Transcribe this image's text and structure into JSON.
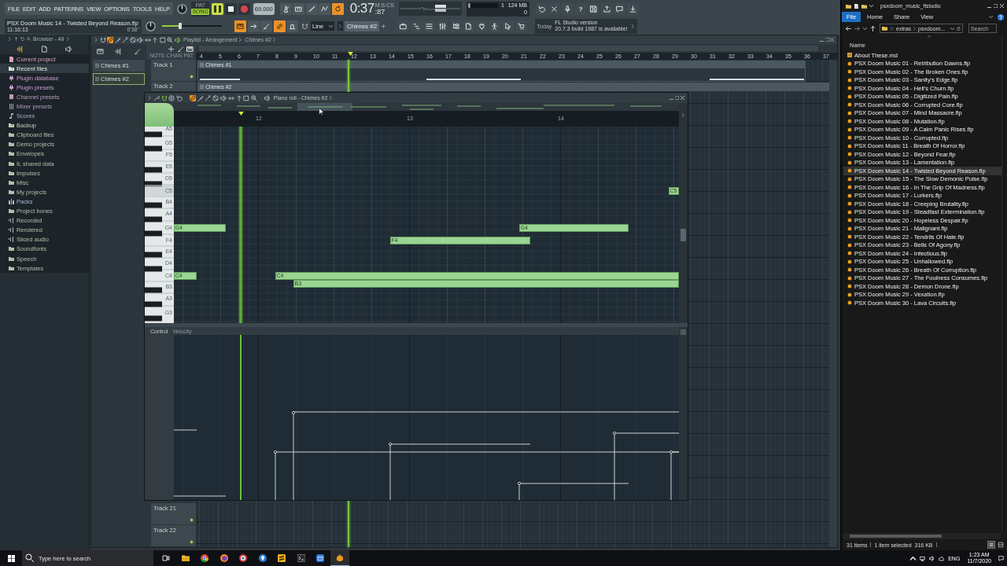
{
  "fl_studio": {
    "menu": [
      "FILE",
      "EDIT",
      "ADD",
      "PATTERNS",
      "VIEW",
      "OPTIONS",
      "TOOLS",
      "HELP"
    ],
    "transport": {
      "modes": [
        {
          "label": "PAT",
          "selected": false
        },
        {
          "label": "SONG",
          "selected": true
        }
      ],
      "playing": true,
      "tempo": "69.000",
      "time": "0:37",
      "time_unit": "M:S:CS",
      "time_fraction": ":87"
    },
    "recording_toggles": [
      {
        "on": false
      },
      {
        "on": false
      },
      {
        "on": false
      },
      {
        "on": false
      },
      {
        "on": true
      }
    ],
    "cpu_panel": {
      "cpu": "1",
      "memory": "124 MB",
      "polyphony": "0"
    },
    "help_button": "?",
    "hint_bar": {
      "title": "PSX Doom Music 14 - Twisted Beyond Reason.flp",
      "time": "11:16:13",
      "length": "0'38\""
    },
    "master_pitch": {
      "level": 0.3
    },
    "edit_toggles": [
      {
        "on": true
      },
      {
        "on": false
      },
      {
        "on": false
      },
      {
        "on": true
      },
      {
        "on": false
      }
    ],
    "snap": "Line",
    "pattern": "Chimes #2",
    "news": {
      "label": "Today",
      "title": "FL Studio version",
      "text": "20.7.3 build 1987 is available!"
    }
  },
  "browser": {
    "title": "Browser - All",
    "items": [
      {
        "label": "Current project",
        "kind": "project",
        "color": "#d9a2b2",
        "selected": false
      },
      {
        "label": "Recent files",
        "kind": "recent",
        "color": "#dfe8d8",
        "selected": true
      },
      {
        "label": "Plugin database",
        "kind": "plugin",
        "color": "#c89ccc",
        "selected": false
      },
      {
        "label": "Plugin presets",
        "kind": "plugin",
        "color": "#c89ccc",
        "selected": false
      },
      {
        "label": "Channel presets",
        "kind": "preset",
        "color": "#b89cbc",
        "selected": false
      },
      {
        "label": "Mixer presets",
        "kind": "mixer",
        "color": "#b09cbc",
        "selected": false
      },
      {
        "label": "Scores",
        "kind": "score",
        "color": "#b0a8c4",
        "selected": false
      },
      {
        "label": "Backup",
        "kind": "recent",
        "color": "#bcd0b4",
        "selected": false
      },
      {
        "label": "Clipboard files",
        "kind": "folder",
        "color": "#b4bcac",
        "selected": false
      },
      {
        "label": "Demo projects",
        "kind": "folder",
        "color": "#b4bcac",
        "selected": false
      },
      {
        "label": "Envelopes",
        "kind": "folder",
        "color": "#b4bcac",
        "selected": false
      },
      {
        "label": "IL shared data",
        "kind": "folder",
        "color": "#b4bcac",
        "selected": false
      },
      {
        "label": "Impulses",
        "kind": "folder",
        "color": "#b4bcac",
        "selected": false
      },
      {
        "label": "Misc",
        "kind": "folder",
        "color": "#b4bcac",
        "selected": false
      },
      {
        "label": "My projects",
        "kind": "folder",
        "color": "#b4bcac",
        "selected": false
      },
      {
        "label": "Packs",
        "kind": "pack",
        "color": "#a8b8d4",
        "selected": false
      },
      {
        "label": "Project bones",
        "kind": "folder",
        "color": "#b4bcac",
        "selected": false
      },
      {
        "label": "Recorded",
        "kind": "audio",
        "color": "#b4bcac",
        "selected": false
      },
      {
        "label": "Rendered",
        "kind": "audio",
        "color": "#b4bcac",
        "selected": false
      },
      {
        "label": "Sliced audio",
        "kind": "audio",
        "color": "#b4bcac",
        "selected": false
      },
      {
        "label": "Soundfonts",
        "kind": "folder",
        "color": "#b4bcac",
        "selected": false
      },
      {
        "label": "Speech",
        "kind": "folder",
        "color": "#b4bcac",
        "selected": false
      },
      {
        "label": "Templates",
        "kind": "folder",
        "color": "#b4bcac",
        "selected": false
      }
    ]
  },
  "patterns": [
    {
      "label": "Chimes #1",
      "selected": false
    },
    {
      "label": "Chimes #2",
      "selected": true
    }
  ],
  "playlist": {
    "title": "Playlist - Arrangement",
    "pattern": "Chimes #2",
    "tools": [
      {
        "selected": true
      },
      {
        "selected": false
      },
      {
        "selected": false
      },
      {
        "selected": false
      },
      {
        "selected": false
      },
      {
        "selected": false
      },
      {
        "selected": false
      },
      {
        "selected": false
      },
      {
        "selected": false
      }
    ],
    "tool_labels": [
      "NOTE",
      "CHAN",
      "PAT"
    ],
    "ruler": [
      "4",
      "5",
      "6",
      "7",
      "8",
      "9",
      "10",
      "11",
      "12",
      "13",
      "14",
      "15",
      "16",
      "17",
      "18",
      "19",
      "20",
      "21",
      "22",
      "23",
      "24",
      "25",
      "26",
      "27",
      "28",
      "29",
      "30",
      "31",
      "32",
      "33",
      "34",
      "35",
      "36",
      "37"
    ],
    "tracks": [
      {
        "name": "Track 1",
        "clip": "Chimes #1"
      },
      {
        "name": "Track 2",
        "clip": "Chimes #2"
      }
    ],
    "lower_tracks": [
      {
        "name": "Track 21"
      },
      {
        "name": "Track 22"
      }
    ]
  },
  "piano_roll": {
    "title": "Piano roll - Chimes #2",
    "tools": [
      {
        "selected": true
      },
      {
        "selected": false
      },
      {
        "selected": false
      },
      {
        "selected": false
      },
      {
        "selected": false
      },
      {
        "selected": false
      },
      {
        "selected": false
      },
      {
        "selected": false
      },
      {
        "selected": false
      }
    ],
    "ruler": [
      "12",
      "13",
      "14"
    ],
    "keys": [
      "A5",
      "G5",
      "F5",
      "E5",
      "D5",
      "C5",
      "B4",
      "A4",
      "G4",
      "F4",
      "E4",
      "D4",
      "C4",
      "B3",
      "A3",
      "G3"
    ],
    "notes": [
      {
        "label": "G4"
      },
      {
        "label": "C4"
      },
      {
        "label": "C4"
      },
      {
        "label": "B3"
      },
      {
        "label": "F4"
      },
      {
        "label": "G4"
      },
      {
        "label": "C5"
      }
    ],
    "control": {
      "label": "Control",
      "target": "Velocity"
    }
  },
  "explorer": {
    "title": "psxdoom_music_flstudio",
    "ribbon": [
      {
        "label": "File",
        "selected": true
      },
      {
        "label": "Home",
        "selected": false
      },
      {
        "label": "Share",
        "selected": false
      },
      {
        "label": "View",
        "selected": false
      }
    ],
    "path": [
      "extras",
      "psxdoom..."
    ],
    "search": {
      "placeholder": "Search"
    },
    "column": "Name",
    "files": [
      {
        "name": "About These.md",
        "kind": "md",
        "selected": false
      },
      {
        "name": "PSX Doom Music 01 - Retribution Dawns.flp",
        "kind": "flp",
        "selected": false
      },
      {
        "name": "PSX Doom Music 02 - The Broken Ones.flp",
        "kind": "flp",
        "selected": false
      },
      {
        "name": "PSX Doom Music 03 - Sanity's Edge.flp",
        "kind": "flp",
        "selected": false
      },
      {
        "name": "PSX Doom Music 04 - Hell's Churn.flp",
        "kind": "flp",
        "selected": false
      },
      {
        "name": "PSX Doom Music 05 - Digitized Pain.flp",
        "kind": "flp",
        "selected": false
      },
      {
        "name": "PSX Doom Music 06 - Corrupted Core.flp",
        "kind": "flp",
        "selected": false
      },
      {
        "name": "PSX Doom Music 07 - Mind Massacre.flp",
        "kind": "flp",
        "selected": false
      },
      {
        "name": "PSX Doom Music 08 - Mutation.flp",
        "kind": "flp",
        "selected": false
      },
      {
        "name": "PSX Doom Music 09 - A Calm Panic Rises.flp",
        "kind": "flp",
        "selected": false
      },
      {
        "name": "PSX Doom Music 10 - Corrupted.flp",
        "kind": "flp",
        "selected": false
      },
      {
        "name": "PSX Doom Music 11 - Breath Of Horror.flp",
        "kind": "flp",
        "selected": false
      },
      {
        "name": "PSX Doom Music 12 - Beyond Fear.flp",
        "kind": "flp",
        "selected": false
      },
      {
        "name": "PSX Doom Music 13 - Lamentation.flp",
        "kind": "flp",
        "selected": false
      },
      {
        "name": "PSX Doom Music 14 - Twisted Beyond Reason.flp",
        "kind": "flp",
        "selected": true
      },
      {
        "name": "PSX Doom Music 15 - The Slow Demonic Pulse.flp",
        "kind": "flp",
        "selected": false
      },
      {
        "name": "PSX Doom Music 16 - In The Grip Of Madness.flp",
        "kind": "flp",
        "selected": false
      },
      {
        "name": "PSX Doom Music 17 - Lurkers.flp",
        "kind": "flp",
        "selected": false
      },
      {
        "name": "PSX Doom Music 18 - Creeping Brutality.flp",
        "kind": "flp",
        "selected": false
      },
      {
        "name": "PSX Doom Music 19 - Steadfast Extermination.flp",
        "kind": "flp",
        "selected": false
      },
      {
        "name": "PSX Doom Music 20 - Hopeless Despair.flp",
        "kind": "flp",
        "selected": false
      },
      {
        "name": "PSX Doom Music 21 - Malignant.flp",
        "kind": "flp",
        "selected": false
      },
      {
        "name": "PSX Doom Music 22 - Tendrils Of Hate.flp",
        "kind": "flp",
        "selected": false
      },
      {
        "name": "PSX Doom Music 23 - Bells Of Agony.flp",
        "kind": "flp",
        "selected": false
      },
      {
        "name": "PSX Doom Music 24 - Infectious.flp",
        "kind": "flp",
        "selected": false
      },
      {
        "name": "PSX Doom Music 25 - Unhallowed.flp",
        "kind": "flp",
        "selected": false
      },
      {
        "name": "PSX Doom Music 26 - Breath Of Corruption.flp",
        "kind": "flp",
        "selected": false
      },
      {
        "name": "PSX Doom Music 27 - The Foulness Consumes.flp",
        "kind": "flp",
        "selected": false
      },
      {
        "name": "PSX Doom Music 28 - Demon Drone.flp",
        "kind": "flp",
        "selected": false
      },
      {
        "name": "PSX Doom Music 29 - Vexation.flp",
        "kind": "flp",
        "selected": false
      },
      {
        "name": "PSX Doom Music 30 - Lava Circuits.flp",
        "kind": "flp",
        "selected": false
      }
    ],
    "status": {
      "count": "31 items",
      "selection": "1 item selected",
      "size": "316 KB"
    }
  },
  "taskbar": {
    "search": {
      "placeholder": "Type here to search"
    },
    "apps": [
      {
        "kind": "taskview",
        "active": false
      },
      {
        "kind": "folder",
        "active": false
      },
      {
        "kind": "circle",
        "active": false
      },
      {
        "kind": "globe",
        "active": false
      },
      {
        "kind": "disc",
        "active": false
      },
      {
        "kind": "pin",
        "active": false
      },
      {
        "kind": "tile",
        "active": false
      },
      {
        "kind": "terminal",
        "active": false
      },
      {
        "kind": "cloud",
        "active": false
      },
      {
        "kind": "fruit",
        "active": true
      }
    ],
    "tray": {
      "language": "ENG",
      "time": "1:23 AM",
      "date": "11/7/2020"
    }
  }
}
